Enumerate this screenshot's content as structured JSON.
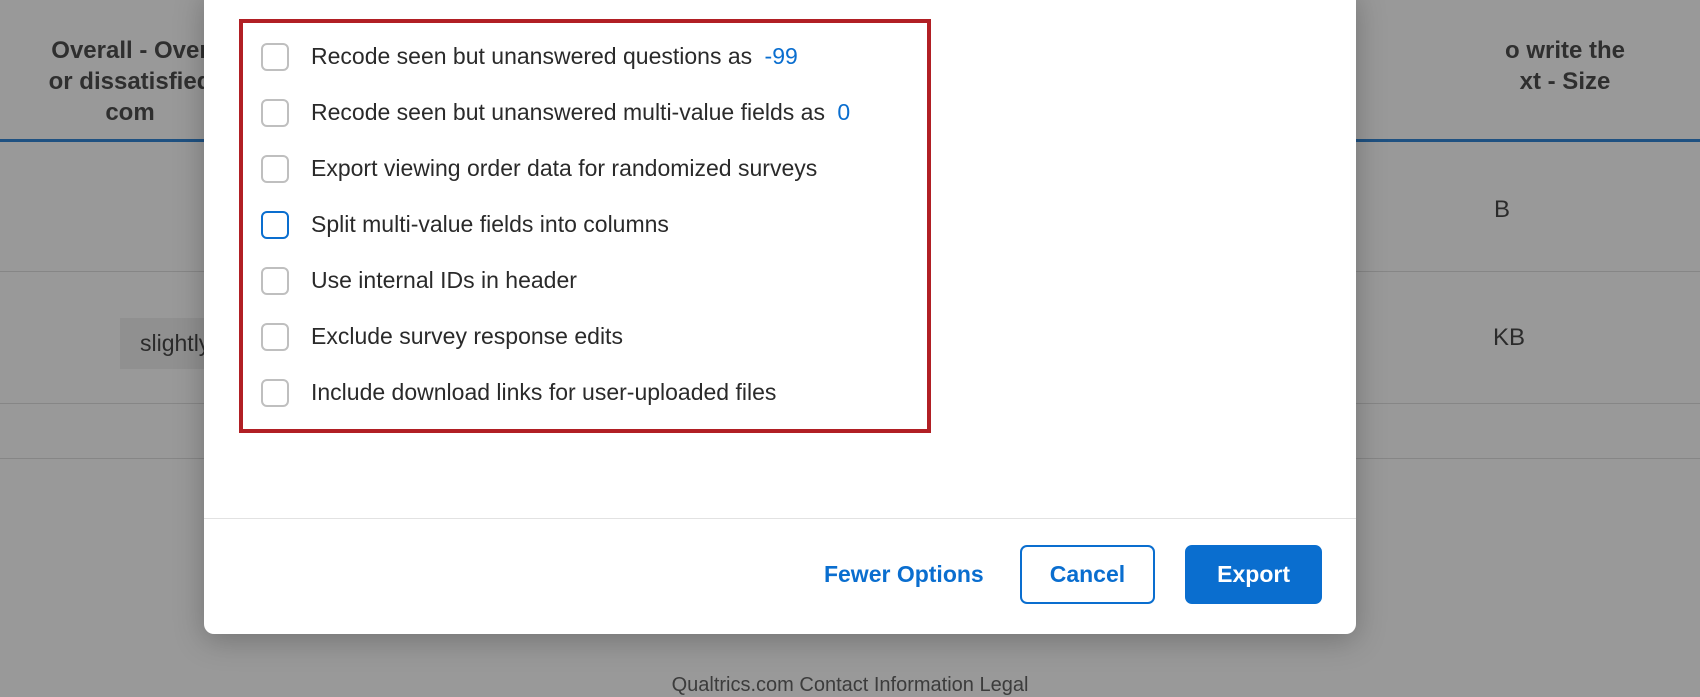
{
  "background": {
    "header_left": "Overall - Over\nor dissatisfied\ncom",
    "header_right": "o write the\nxt - Size",
    "chip": "slightly",
    "b1": "B",
    "b2": "KB",
    "footer": "Qualtrics.com    Contact Information    Legal"
  },
  "modal": {
    "options": [
      {
        "label": "Recode seen but unanswered questions as",
        "value": "-99",
        "checked": false,
        "focused": false
      },
      {
        "label": "Recode seen but unanswered multi-value fields as",
        "value": "0",
        "checked": false,
        "focused": false
      },
      {
        "label": "Export viewing order data for randomized surveys",
        "value": "",
        "checked": false,
        "focused": false
      },
      {
        "label": "Split multi-value fields into columns",
        "value": "",
        "checked": false,
        "focused": true
      },
      {
        "label": "Use internal IDs in header",
        "value": "",
        "checked": false,
        "focused": false
      },
      {
        "label": "Exclude survey response edits",
        "value": "",
        "checked": false,
        "focused": false
      },
      {
        "label": "Include download links for user-uploaded files",
        "value": "",
        "checked": false,
        "focused": false
      }
    ],
    "footer": {
      "fewer": "Fewer Options",
      "cancel": "Cancel",
      "export": "Export"
    }
  }
}
